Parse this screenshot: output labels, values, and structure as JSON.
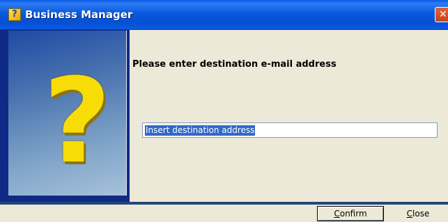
{
  "window": {
    "title": "Business Manager",
    "close_glyph": "✕",
    "title_icon_glyph": "?",
    "title_icon": "question-help-icon"
  },
  "main": {
    "image_glyph": "?",
    "image_icon": "question-mark-icon",
    "prompt": "Please enter destination e-mail address",
    "address_input": {
      "value": "Insert destination address"
    }
  },
  "buttons": {
    "confirm_first": "C",
    "confirm_rest": "onfirm",
    "close_first": "C",
    "close_rest": "lose"
  },
  "colors": {
    "titlebar": "#0a58de",
    "panel_gradient_start": "#1f4aa4",
    "panel_gradient_end": "#a7c1da",
    "question_mark": "#f8dc08",
    "selection": "#3169c6",
    "dialog_bg": "#ece9d8"
  }
}
